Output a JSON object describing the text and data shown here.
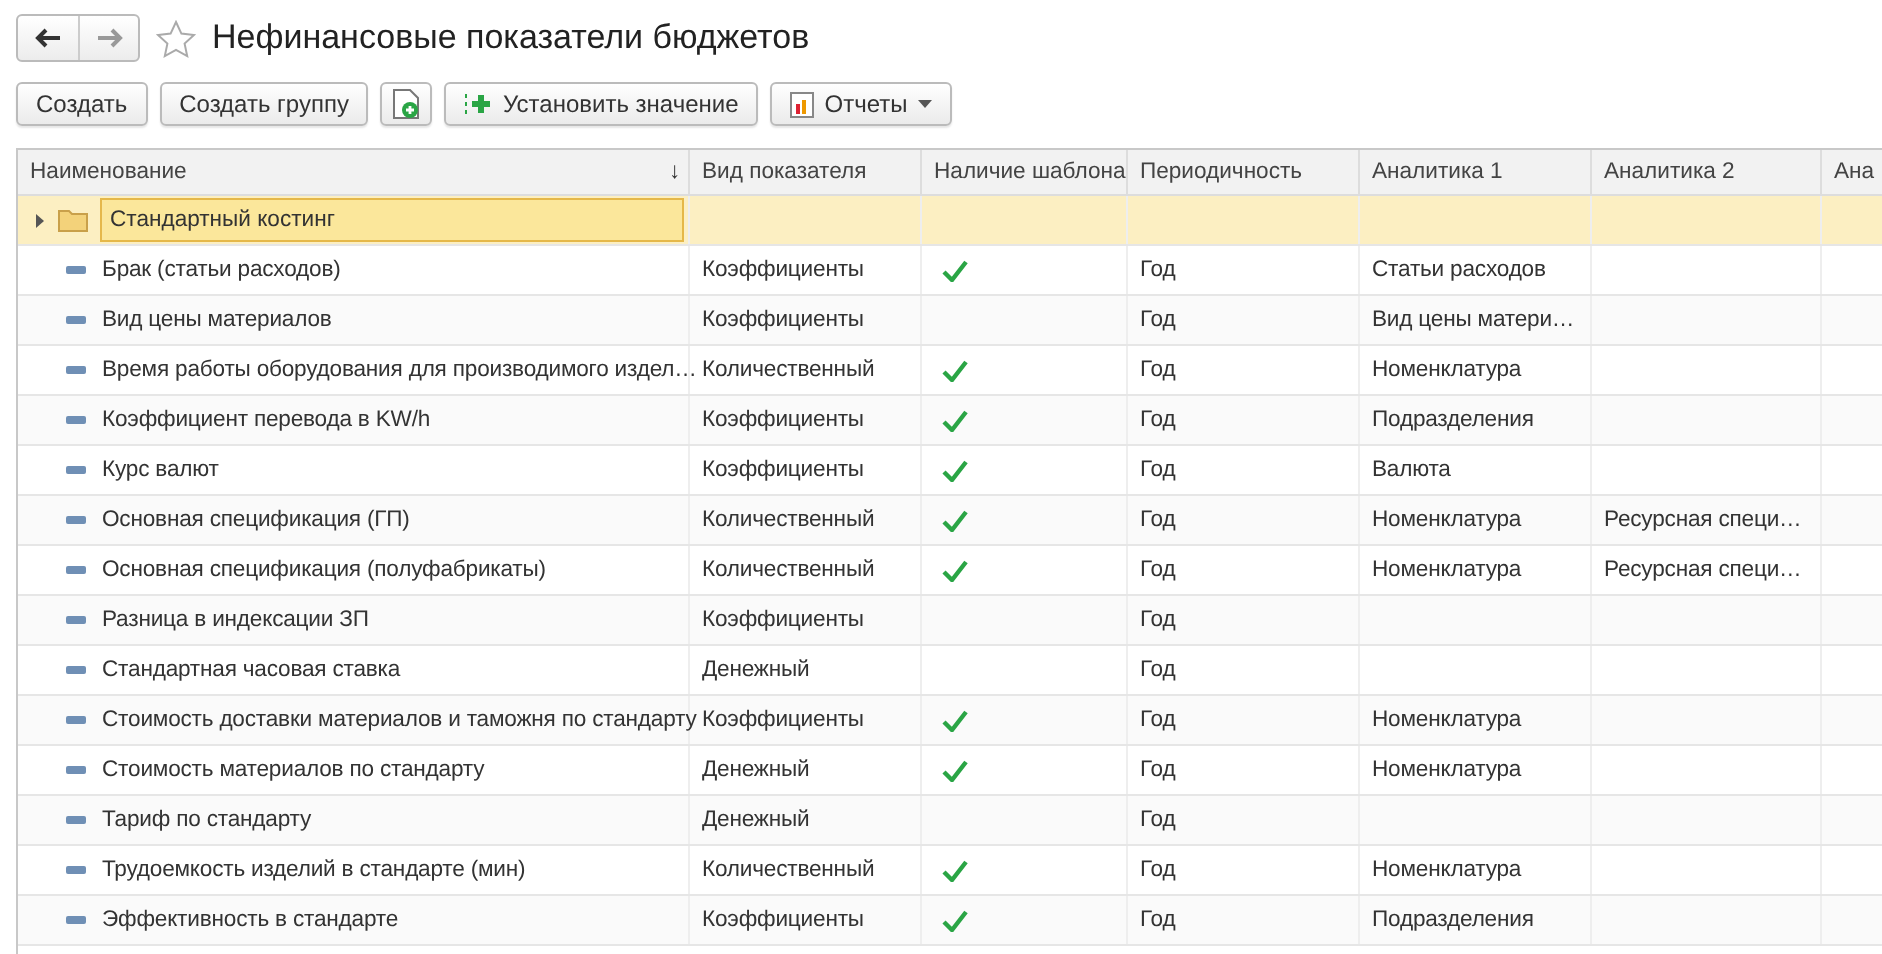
{
  "window": {
    "title": "Нефинансовые показатели бюджетов",
    "favorite": false
  },
  "toolbar": [
    {
      "kind": "text",
      "label": "Создать"
    },
    {
      "kind": "text",
      "label": "Создать группу"
    },
    {
      "kind": "icon"
    },
    {
      "kind": "add",
      "label": "Установить значение"
    },
    {
      "kind": "menu",
      "label": "Отчеты"
    }
  ],
  "table": {
    "columns": [
      {
        "label": "Наименование",
        "sort_indicator": "↓"
      },
      {
        "label": "Вид показателя"
      },
      {
        "label": "Наличие шаблона"
      },
      {
        "label": "Периодичность"
      },
      {
        "label": "Аналитика 1"
      },
      {
        "label": "Аналитика 2"
      },
      {
        "label": "Ана"
      }
    ],
    "rows": [
      {
        "kind": "group",
        "name": "Стандартный костинг",
        "expanded": false,
        "selected": true
      },
      {
        "kind": "item",
        "selected": false,
        "name": "Брак (статьи расходов)",
        "type": "Коэффициенты",
        "has_template": true,
        "period": "Год",
        "analytics_1": "Статьи расходов"
      },
      {
        "kind": "item",
        "selected": false,
        "name": "Вид цены материалов",
        "type": "Коэффициенты",
        "has_template": false,
        "period": "Год",
        "analytics_1": "Вид цены матери…"
      },
      {
        "kind": "item",
        "selected": false,
        "name": "Время работы оборудования для производимого издел…",
        "type": "Количественный",
        "has_template": true,
        "period": "Год",
        "analytics_1": "Номенклатура"
      },
      {
        "kind": "item",
        "selected": false,
        "name": "Коэффициент перевода в KW/h",
        "type": "Коэффициенты",
        "has_template": true,
        "period": "Год",
        "analytics_1": "Подразделения"
      },
      {
        "kind": "item",
        "selected": false,
        "name": "Курс валют",
        "type": "Коэффициенты",
        "has_template": true,
        "period": "Год",
        "analytics_1": "Валюта"
      },
      {
        "kind": "item",
        "selected": false,
        "name": "Основная спецификация (ГП)",
        "type": "Количественный",
        "has_template": true,
        "period": "Год",
        "analytics_1": "Номенклатура",
        "analytics_2": "Ресурсная специ…"
      },
      {
        "kind": "item",
        "selected": false,
        "name": "Основная спецификация (полуфабрикаты)",
        "type": "Количественный",
        "has_template": true,
        "period": "Год",
        "analytics_1": "Номенклатура",
        "analytics_2": "Ресурсная специ…"
      },
      {
        "kind": "item",
        "selected": false,
        "name": "Разница в индексации ЗП",
        "type": "Коэффициенты",
        "has_template": false,
        "period": "Год"
      },
      {
        "kind": "item",
        "selected": false,
        "name": "Стандартная часовая ставка",
        "type": "Денежный",
        "has_template": false,
        "period": "Год"
      },
      {
        "kind": "item",
        "selected": false,
        "name": "Стоимость доставки материалов и таможня по стандарту",
        "type": "Коэффициенты",
        "has_template": true,
        "period": "Год",
        "analytics_1": "Номенклатура"
      },
      {
        "kind": "item",
        "selected": false,
        "name": "Стоимость материалов по стандарту",
        "type": "Денежный",
        "has_template": true,
        "period": "Год",
        "analytics_1": "Номенклатура"
      },
      {
        "kind": "item",
        "selected": false,
        "name": "Тариф по стандарту",
        "type": "Денежный",
        "has_template": false,
        "period": "Год"
      },
      {
        "kind": "item",
        "selected": false,
        "name": "Трудоемкость изделий в стандарте (мин)",
        "type": "Количественный",
        "has_template": true,
        "period": "Год",
        "analytics_1": "Номенклатура"
      },
      {
        "kind": "item",
        "selected": false,
        "name": "Эффективность в стандарте",
        "type": "Коэффициенты",
        "has_template": true,
        "period": "Год",
        "analytics_1": "Подразделения"
      }
    ]
  }
}
